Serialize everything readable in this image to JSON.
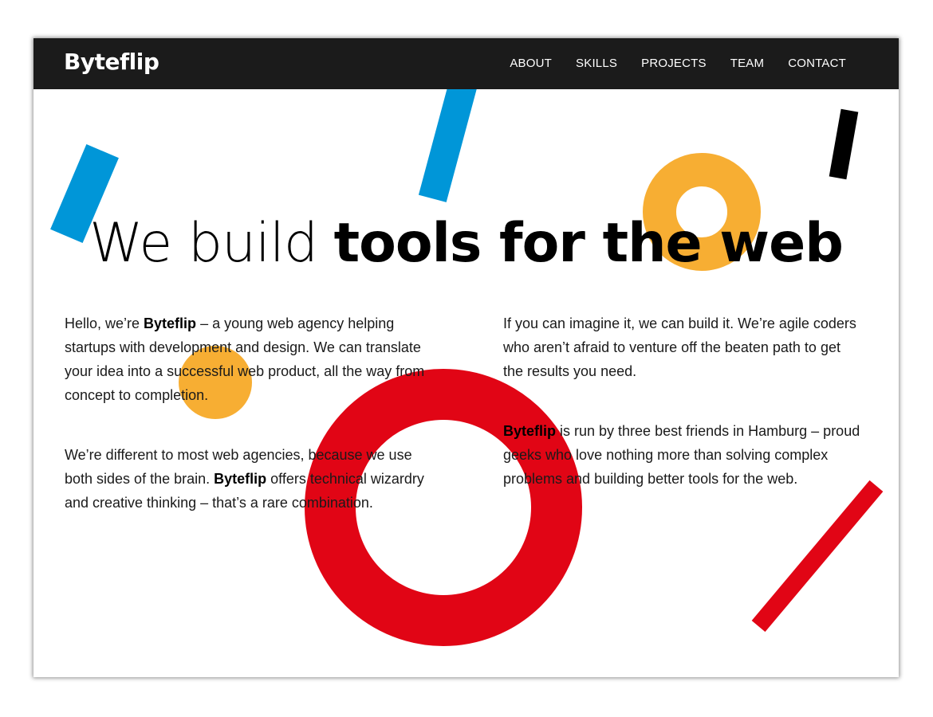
{
  "brand": {
    "name": "Byteflip"
  },
  "nav": [
    {
      "label": "ABOUT"
    },
    {
      "label": "SKILLS"
    },
    {
      "label": "PROJECTS"
    },
    {
      "label": "TEAM"
    },
    {
      "label": "CONTACT"
    }
  ],
  "hero": {
    "light": "We build",
    "bold": "tools for the web"
  },
  "left_column": {
    "p1": {
      "a": "Hello, we’re ",
      "brand": "Byteflip",
      "b": " – a young web agency helping startups with development and design. We can translate your idea into a successful web product, all the way from concept to completion."
    },
    "p2": {
      "a": "We’re different to most web agencies, because we use both sides of the brain. ",
      "brand": "Byteflip",
      "b": " offers technical wizardry and creative thinking – that’s a rare combination."
    }
  },
  "right_column": {
    "p1": {
      "a": "If you can imagine it, we can build it. We’re agile coders who aren’t afraid to venture off the beaten path to get the results you need."
    },
    "p2": {
      "brand": "Byteflip",
      "b": " is run by three best friends in Hamburg – proud geeks who love nothing more than solving complex problems and building better tools for the web."
    }
  },
  "colors": {
    "blue": "#0096d8",
    "yellow": "#f7ae33",
    "red": "#e10515",
    "black": "#000000",
    "navbar": "#1b1b1b"
  },
  "decorations": [
    "blue-bar",
    "blue-bar",
    "black-bar",
    "yellow-ring",
    "yellow-dot",
    "red-ring",
    "red-bar"
  ]
}
